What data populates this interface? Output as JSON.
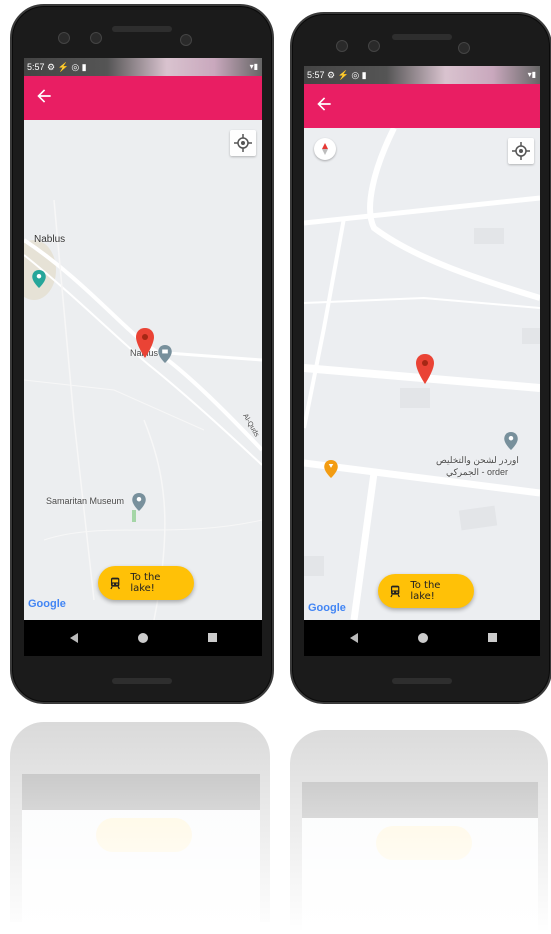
{
  "phones": [
    {
      "status_time": "5:57",
      "status_icons": "⚙ ⚡ ◎ ▮",
      "status_right": "▾▮",
      "fab_label": "To the lake!",
      "google_label": "Google",
      "map_labels": {
        "city": "Nablus",
        "poi1": "Nablus",
        "museum": "Samaritan Museum",
        "road": "Al-Quds"
      }
    },
    {
      "status_time": "5:57",
      "status_icons": "⚙ ⚡ ◎ ▮",
      "status_right": "▾▮",
      "fab_label": "To the lake!",
      "google_label": "Google",
      "map_labels": {
        "business_ar": "اوردر لشحن والتخليص",
        "business_ar2": "الجمركي - order"
      }
    }
  ],
  "colors": {
    "appbar": "#e91e63",
    "fab": "#ffc107",
    "marker": "#ea4335"
  }
}
